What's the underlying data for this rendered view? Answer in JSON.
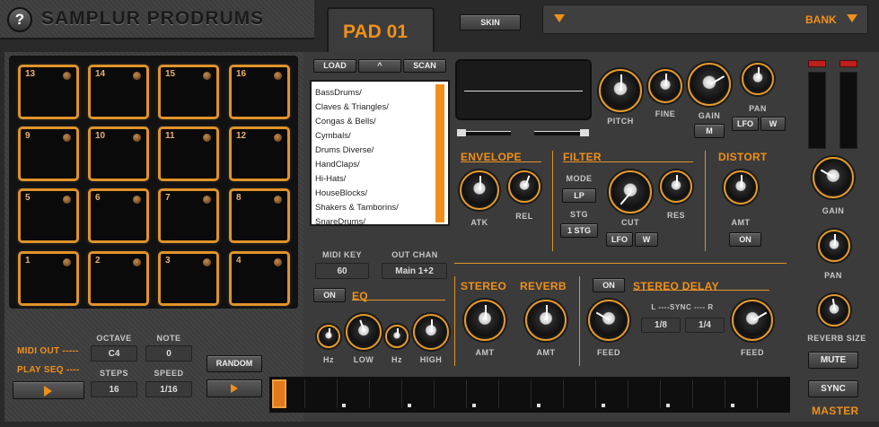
{
  "header": {
    "help_label": "?",
    "title": "SAMPLUR PRODRUMS",
    "pad_title": "PAD 01",
    "skin_label": "SKIN",
    "bank_label": "BANK"
  },
  "pads": [
    {
      "num": "13"
    },
    {
      "num": "14"
    },
    {
      "num": "15"
    },
    {
      "num": "16"
    },
    {
      "num": "9"
    },
    {
      "num": "10"
    },
    {
      "num": "11"
    },
    {
      "num": "12"
    },
    {
      "num": "5"
    },
    {
      "num": "6"
    },
    {
      "num": "7"
    },
    {
      "num": "8"
    },
    {
      "num": "1"
    },
    {
      "num": "2"
    },
    {
      "num": "3"
    },
    {
      "num": "4"
    }
  ],
  "browser": {
    "load_label": "LOAD",
    "up_label": "^",
    "scan_label": "SCAN",
    "items": [
      "BassDrums/",
      "Claves & Triangles/",
      "Congas & Bells/",
      "Cymbals/",
      "Drums Diverse/",
      "HandClaps/",
      "Hi-Hats/",
      "HouseBlocks/",
      "Shakers & Tamborins/",
      "SnareDrums/"
    ],
    "midi_key_label": "MIDI KEY",
    "midi_key_value": "60",
    "out_chan_label": "OUT CHAN",
    "out_chan_value": "Main 1+2"
  },
  "tone": {
    "pitch_label": "PITCH",
    "fine_label": "FINE",
    "gain_label": "GAIN",
    "pan_label": "PAN",
    "m_label": "M",
    "lfo_label": "LFO",
    "w_label": "W"
  },
  "envelope": {
    "title": "ENVELOPE",
    "atk_label": "ATK",
    "rel_label": "REL"
  },
  "filter": {
    "title": "FILTER",
    "mode_label": "MODE",
    "mode_value": "LP",
    "stg_label": "STG",
    "stg_value": "1 STG",
    "cut_label": "CUT",
    "res_label": "RES",
    "lfo_label": "LFO",
    "w_label": "W"
  },
  "distort": {
    "title": "DISTORT",
    "amt_label": "AMT",
    "on_label": "ON"
  },
  "eq": {
    "on_label": "ON",
    "title": "EQ",
    "hz1_label": "Hz",
    "low_label": "LOW",
    "hz2_label": "Hz",
    "high_label": "HIGH"
  },
  "stereo": {
    "title": "STEREO",
    "amt_label": "AMT"
  },
  "reverb": {
    "title": "REVERB",
    "amt_label": "AMT"
  },
  "delay": {
    "on_label": "ON",
    "title": "STEREO DELAY",
    "feed_l_label": "FEED",
    "feed_r_label": "FEED",
    "sync_label": "L ----SYNC ---- R",
    "l_value": "1/8",
    "r_value": "1/4"
  },
  "master": {
    "gain_label": "GAIN",
    "pan_label": "PAN",
    "reverb_size_label": "REVERB SIZE",
    "mute_label": "MUTE",
    "sync_label": "SYNC",
    "title": "MASTER"
  },
  "seq": {
    "midi_out_label": "MIDI OUT -----",
    "play_seq_label": "PLAY SEQ ----",
    "octave_label": "OCTAVE",
    "octave_value": "C4",
    "note_label": "NOTE",
    "note_value": "0",
    "steps_label": "STEPS",
    "steps_value": "16",
    "speed_label": "SPEED",
    "speed_value": "1/16",
    "random_label": "RANDOM",
    "play_icon": "play-icon"
  },
  "colors": {
    "accent": "#e0932a",
    "panel": "#363636",
    "pad_fill": "#0a0a0a",
    "list_bg": "#ffffff",
    "meter_red": "#c0201c"
  }
}
